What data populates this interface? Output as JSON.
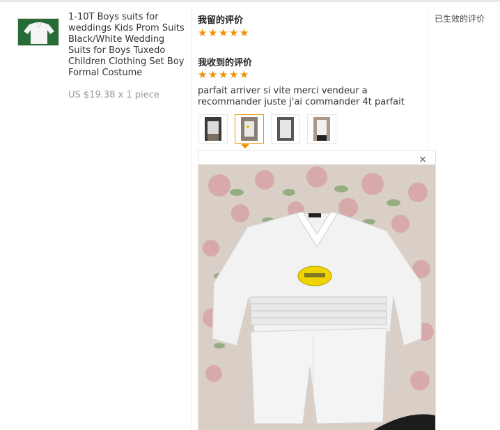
{
  "product": {
    "title": "1-10T Boys suits for weddings Kids Prom Suits Black/White Wedding Suits for Boys Tuxedo Children Clothing Set Boy Formal Costume",
    "price": "US $19.38 x 1 piece"
  },
  "my_review": {
    "label": "我留的评价",
    "rating": 5
  },
  "received_review": {
    "label": "我收到的评价",
    "rating": 5,
    "text": "parfait arriver si vite merci vendeur a recommander juste j'ai commander 4t parfait"
  },
  "photos": {
    "thumbnails": [
      "photo-1",
      "photo-2",
      "photo-3",
      "photo-4"
    ],
    "selected_index": 1,
    "close_symbol": "×"
  },
  "status": "已生效的评价",
  "colors": {
    "star": "#f29000",
    "active_border": "#f29000",
    "price_text": "#999999"
  }
}
